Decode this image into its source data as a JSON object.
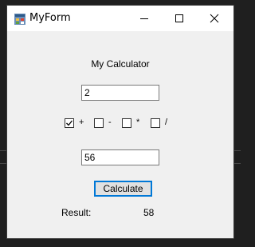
{
  "window": {
    "title": "MyForm"
  },
  "form": {
    "heading": "My Calculator",
    "input1": "2",
    "input2": "56",
    "operations": [
      {
        "label": "+",
        "checked": true
      },
      {
        "label": "-",
        "checked": false
      },
      {
        "label": "*",
        "checked": false
      },
      {
        "label": "/",
        "checked": false
      }
    ],
    "calculate_label": "Calculate",
    "result_label": "Result:",
    "result_value": "58"
  },
  "colors": {
    "accent": "#0078d7",
    "window_bg": "#f0f0f0",
    "desktop_bg": "#1f1f1f"
  }
}
